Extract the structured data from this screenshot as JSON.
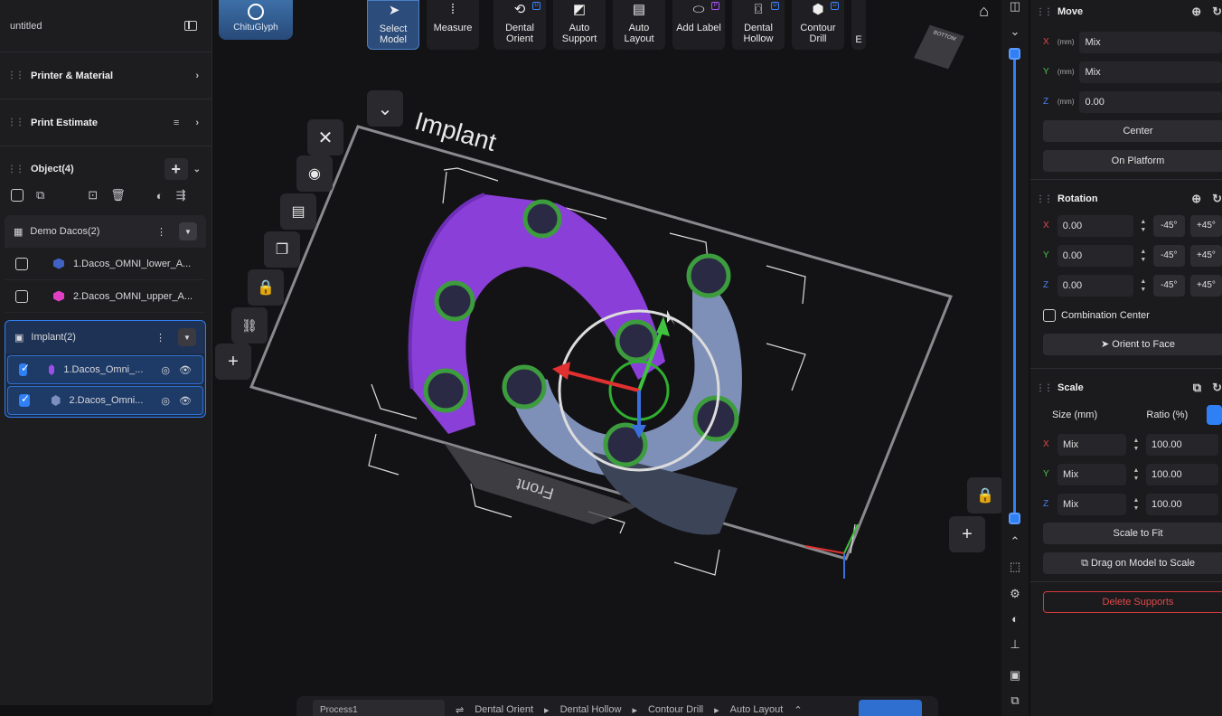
{
  "left": {
    "title": "untitled",
    "sections": [
      {
        "label": "Printer & Material"
      },
      {
        "label": "Print Estimate"
      }
    ],
    "objects": {
      "label": "Object(4)",
      "groups": [
        {
          "name": "Demo Dacos(2)",
          "items": [
            {
              "label": "1.Dacos_OMNI_lower_A...",
              "color": "#3f62c4"
            },
            {
              "label": "2.Dacos_OMNI_upper_A...",
              "color": "#e23fc7"
            }
          ]
        },
        {
          "name": "Implant(2)",
          "items": [
            {
              "label": "1.Dacos_Omni_...",
              "color": "#9b4fe6"
            },
            {
              "label": "2.Dacos_Omni...",
              "color": "#7a8fc0"
            }
          ]
        }
      ]
    }
  },
  "toolbar": {
    "logo": "ChituGlyph",
    "buttons": [
      {
        "label": "Select Model",
        "icon": "cursor-icon"
      },
      {
        "label": "Measure",
        "icon": "ruler-icon"
      },
      {
        "label": "Dental Orient",
        "icon": "orient-icon"
      },
      {
        "label": "Auto Support",
        "icon": "support-icon"
      },
      {
        "label": "Auto Layout",
        "icon": "layout-icon"
      },
      {
        "label": "Add Label",
        "icon": "label-icon"
      },
      {
        "label": "Dental Hollow",
        "icon": "hollow-icon"
      },
      {
        "label": "Contour Drill",
        "icon": "drill-icon"
      },
      {
        "label": "E",
        "icon": "more-icon"
      }
    ]
  },
  "viewport": {
    "plate_title": "Implant",
    "front_label": "Front",
    "cube_label": "BOTTOM"
  },
  "bottombar": {
    "process": "Process1",
    "steps": [
      "Dental Orient",
      "Dental Hollow",
      "Contour Drill",
      "Auto Layout"
    ]
  },
  "right": {
    "move": {
      "title": "Move",
      "fields": [
        {
          "axis": "X",
          "unit": "(mm)",
          "value": "Mix",
          "color": "#e04848"
        },
        {
          "axis": "Y",
          "unit": "(mm)",
          "value": "Mix",
          "color": "#4cc24c"
        },
        {
          "axis": "Z",
          "unit": "(mm)",
          "value": "0.00",
          "color": "#4a7ff0"
        }
      ],
      "center": "Center",
      "on_platform": "On Platform"
    },
    "rotation": {
      "title": "Rotation",
      "fields": [
        {
          "axis": "X",
          "value": "0.00",
          "minus": "-45°",
          "plus": "+45°",
          "color": "#e04848"
        },
        {
          "axis": "Y",
          "value": "0.00",
          "minus": "-45°",
          "plus": "+45°",
          "color": "#4cc24c"
        },
        {
          "axis": "Z",
          "value": "0.00",
          "minus": "-45°",
          "plus": "+45°",
          "color": "#4a7ff0"
        }
      ],
      "combination": "Combination Center",
      "orient_face": "Orient to Face"
    },
    "scale": {
      "title": "Scale",
      "size_label": "Size (mm)",
      "ratio_label": "Ratio (%)",
      "fields": [
        {
          "axis": "X",
          "size": "Mix",
          "ratio": "100.00",
          "color": "#e04848"
        },
        {
          "axis": "Y",
          "size": "Mix",
          "ratio": "100.00",
          "color": "#4cc24c"
        },
        {
          "axis": "Z",
          "size": "Mix",
          "ratio": "100.00",
          "color": "#4a7ff0"
        }
      ],
      "fit": "Scale to Fit",
      "drag": "Drag on Model to Scale"
    },
    "delete_supports": "Delete Supports"
  }
}
